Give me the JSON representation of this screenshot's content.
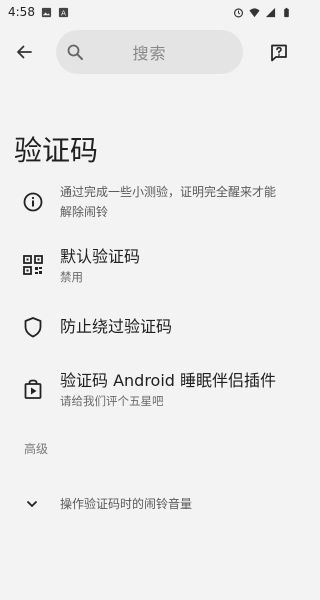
{
  "status_bar": {
    "time": "4:58"
  },
  "search": {
    "placeholder": "搜索"
  },
  "page": {
    "title": "验证码"
  },
  "info": {
    "text": "通过完成一些小测验，证明完全醒来才能解除闹铃"
  },
  "items": [
    {
      "title": "默认验证码",
      "subtitle": "禁用",
      "icon": "qr-code-icon"
    },
    {
      "title": "防止绕过验证码",
      "subtitle": "",
      "icon": "shield-icon"
    },
    {
      "title": "验证码 Android 睡眠伴侣插件",
      "subtitle": "请给我们评个五星吧",
      "icon": "store-icon"
    }
  ],
  "advanced": {
    "header": "高级",
    "expand_label": "操作验证码时的闹铃音量"
  },
  "colors": {
    "background": "#f3f3f3",
    "search_bg": "#e4e4e4",
    "text": "#1f1f1f",
    "secondary": "#6a6a6a"
  }
}
